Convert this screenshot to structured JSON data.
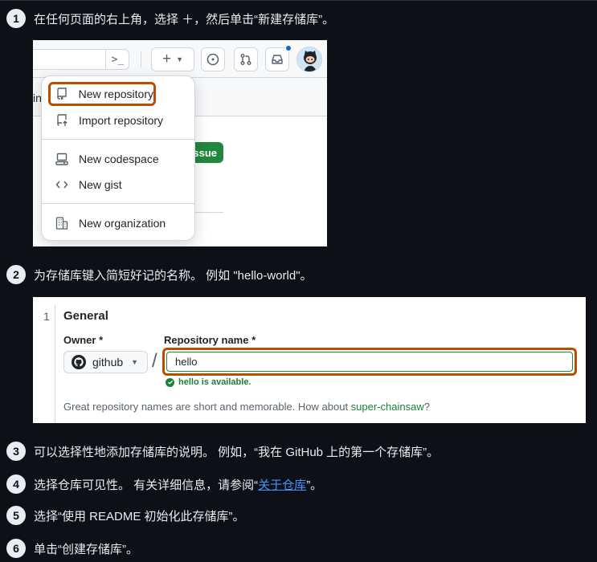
{
  "steps": [
    {
      "num": "1",
      "text": "在任何页面的右上角，选择 ＋，然后单击“新建存储库”。"
    },
    {
      "num": "2",
      "text": "为存储库键入简短好记的名称。 例如 \"hello-world\"。"
    },
    {
      "num": "3",
      "text": "可以选择性地添加存储库的说明。 例如，“我在 GitHub 上的第一个存储库”。"
    },
    {
      "num": "4",
      "text_before": "选择仓库可见性。 有关详细信息，请参阅“",
      "link": "关于仓库",
      "text_after": "”。"
    },
    {
      "num": "5",
      "text": "选择“使用 README 初始化此存储库”。"
    },
    {
      "num": "6",
      "text": "单击“创建存储库”。"
    }
  ],
  "shot1": {
    "in_fragment": "in",
    "green_button": "ssue",
    "menu": [
      {
        "label": "New repository",
        "icon": "repo-icon"
      },
      {
        "label": "Import repository",
        "icon": "repo-push-icon"
      },
      {
        "label": "New codespace",
        "icon": "codespaces-icon"
      },
      {
        "label": "New gist",
        "icon": "code-icon"
      },
      {
        "label": "New organization",
        "icon": "organization-icon"
      }
    ]
  },
  "shot2": {
    "line_number": "1",
    "section": "General",
    "owner_label": "Owner *",
    "owner_value": "github",
    "slash": "/",
    "repo_label": "Repository name *",
    "repo_value": "hello",
    "available": "hello is available.",
    "hint_before": "Great repository names are short and memorable. How about ",
    "hint_suggestion": "super-chainsaw",
    "hint_after": "?"
  },
  "colors": {
    "background": "#0d1117",
    "highlight": "#bc4c00",
    "success": "#1a7f37",
    "link": "#4493f8"
  }
}
